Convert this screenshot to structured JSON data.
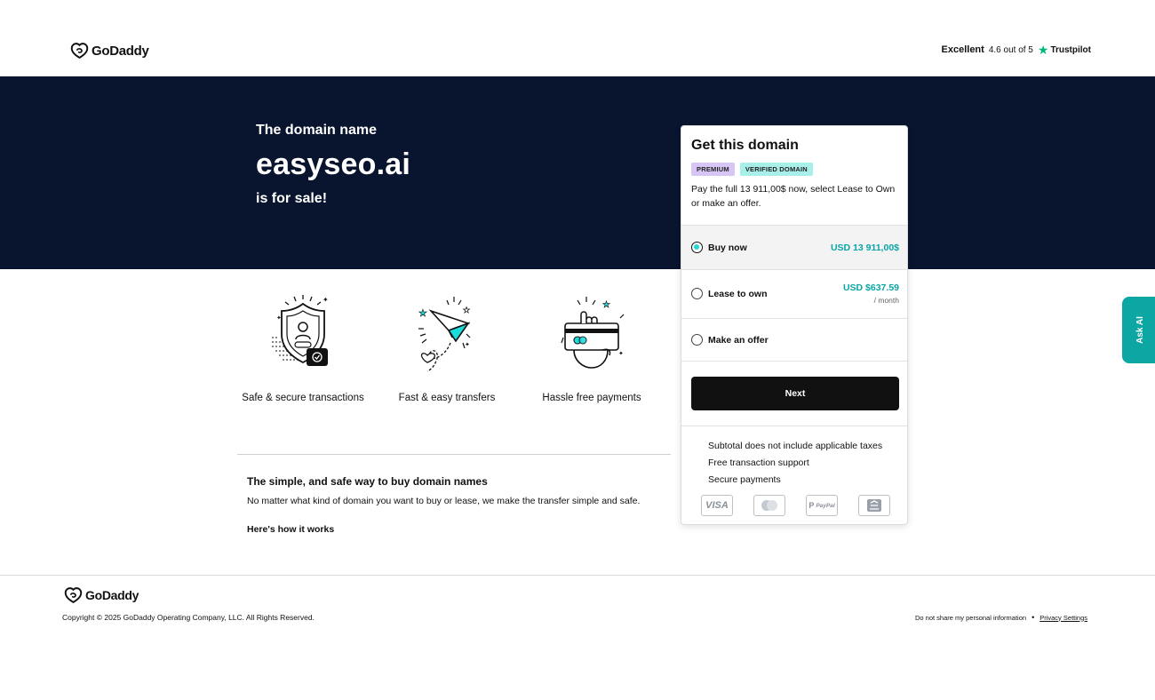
{
  "header": {
    "logo_text": "GoDaddy",
    "rating_word": "Excellent",
    "rating_score": "4.6 out of 5",
    "trustpilot_label": "Trustpilot"
  },
  "hero": {
    "pre": "The domain name",
    "domain": "easyseo.ai",
    "post": "is for sale!"
  },
  "features": [
    {
      "label": "Safe & secure transactions",
      "icon": "shield-icon"
    },
    {
      "label": "Fast & easy transfers",
      "icon": "paper-plane-icon"
    },
    {
      "label": "Hassle free payments",
      "icon": "card-hand-icon"
    }
  ],
  "info": {
    "title": "The simple, and safe way to buy domain names",
    "desc": "No matter what kind of domain you want to buy or lease, we make the transfer simple and safe.",
    "link": "Here's how it works"
  },
  "card": {
    "title": "Get this domain",
    "badges": [
      "PREMIUM",
      "VERIFIED DOMAIN"
    ],
    "desc": "Pay the full 13 911,00$ now, select Lease to Own or make an offer.",
    "options": [
      {
        "label": "Buy now",
        "price": "USD 13 911,00$",
        "selected": true
      },
      {
        "label": "Lease to own",
        "price": "USD $637.59",
        "per": "/ month",
        "selected": false
      },
      {
        "label": "Make an offer",
        "selected": false
      }
    ],
    "next_label": "Next",
    "notes": [
      "Subtotal does not include applicable taxes",
      "Free transaction support",
      "Secure payments"
    ],
    "payment_icons": [
      "visa-icon",
      "mastercard-icon",
      "paypal-icon",
      "bank-icon"
    ],
    "visa_text": "VISA",
    "paypal_text": "PayPal"
  },
  "ask_ai": "Ask AI",
  "footer": {
    "logo_text": "GoDaddy",
    "copyright": "Copyright © 2025 GoDaddy Operating Company, LLC. All Rights Reserved.",
    "do_not_share": "Do not share my personal information",
    "privacy": "Privacy Settings"
  },
  "colors": {
    "hero_bg": "#09152e",
    "accent_teal": "#09a5a5",
    "radio_fill": "#1bdbdb",
    "premium_badge": "#d7c6f5",
    "verified_badge": "#a8efea",
    "ask_ai_bg": "#0ca7a2",
    "trustpilot_star": "#00b67a"
  }
}
